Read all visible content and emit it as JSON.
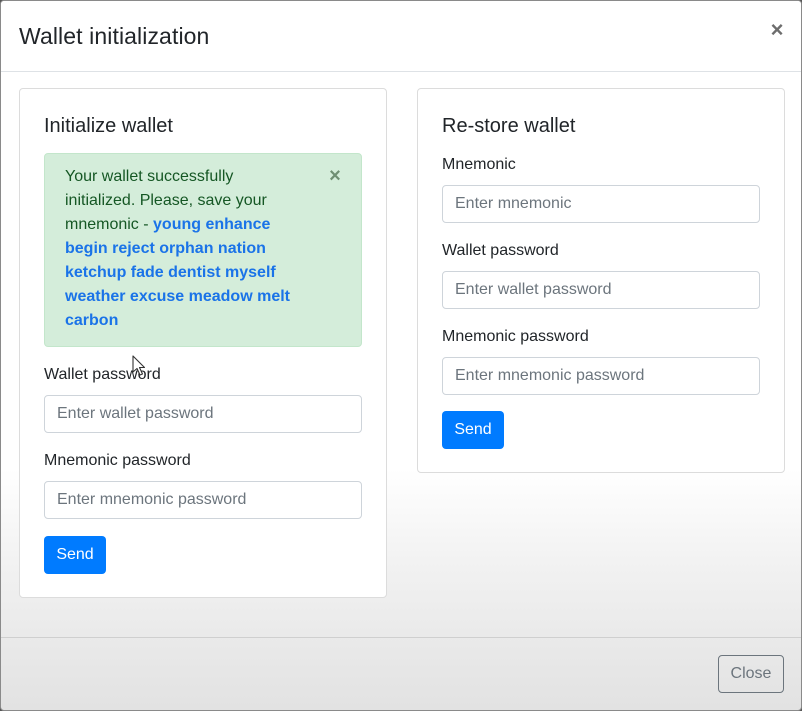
{
  "modal": {
    "title": "Wallet initialization",
    "close_icon": "×"
  },
  "init": {
    "title": "Initialize wallet",
    "alert": {
      "message": "Your wallet successfully initialized. Please, save your mnemonic - ",
      "mnemonic": "young enhance begin reject orphan nation ketchup fade dentist myself weather excuse meadow melt carbon",
      "close_icon": "×"
    },
    "wallet_password_label": "Wallet password",
    "wallet_password_placeholder": "Enter wallet password",
    "mnemonic_password_label": "Mnemonic password",
    "mnemonic_password_placeholder": "Enter mnemonic password",
    "send_label": "Send"
  },
  "restore": {
    "title": "Re-store wallet",
    "mnemonic_label": "Mnemonic",
    "mnemonic_placeholder": "Enter mnemonic",
    "wallet_password_label": "Wallet password",
    "wallet_password_placeholder": "Enter wallet password",
    "mnemonic_password_label": "Mnemonic password",
    "mnemonic_password_placeholder": "Enter mnemonic password",
    "send_label": "Send"
  },
  "footer": {
    "close_label": "Close"
  },
  "colors": {
    "primary": "#007bff",
    "alert_bg": "#d4edda",
    "alert_text": "#155724",
    "mnemonic_text": "#1a73e8",
    "secondary": "#6c757d"
  },
  "icons": {
    "header_close": "close-icon",
    "alert_close": "close-icon",
    "pointer": "mouse-cursor-icon"
  }
}
